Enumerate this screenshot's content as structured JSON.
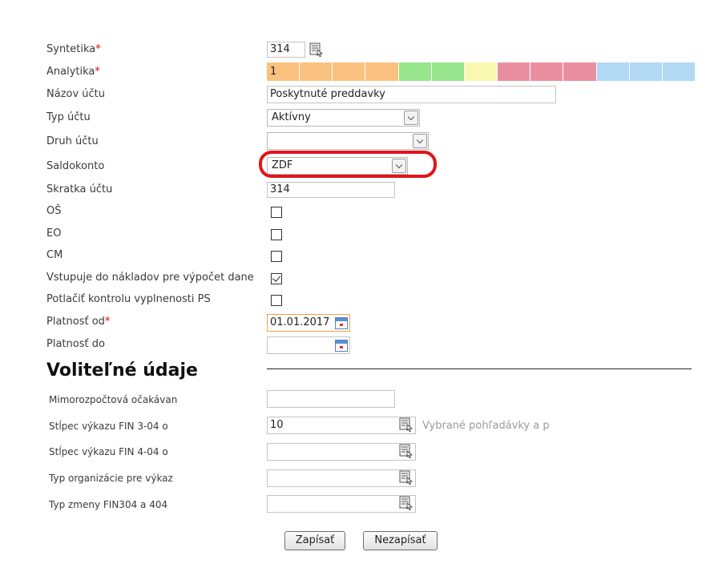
{
  "fields": {
    "syntetika": {
      "label": "Syntetika",
      "required": "*",
      "value": "314"
    },
    "analytika": {
      "label": "Analytika",
      "required": "*",
      "value": "1",
      "segment_colors": [
        "#fbc17e",
        "#fbc17e",
        "#fbc17e",
        "#fbc17e",
        "#97e68c",
        "#97e68c",
        "#faf7b0",
        "#ea8fa2",
        "#ea8fa2",
        "#ea8fa2",
        "#b1d8f5",
        "#b1d8f5",
        "#b1d8f5"
      ]
    },
    "nazov_uctu": {
      "label": "Názov účtu",
      "value": "Poskytnuté preddavky"
    },
    "typ_uctu": {
      "label": "Typ účtu",
      "value": "Aktívny"
    },
    "druh_uctu": {
      "label": "Druh účtu",
      "value": ""
    },
    "saldokonto": {
      "label": "Saldokonto",
      "value": "ZDF"
    },
    "skratka_uctu": {
      "label": "Skratka účtu",
      "value": "314"
    },
    "os": {
      "label": "OŠ",
      "checked": false
    },
    "eo": {
      "label": "EO",
      "checked": false
    },
    "cm": {
      "label": "CM",
      "checked": false
    },
    "vstupuje": {
      "label": "Vstupuje do nákladov pre výpočet dane",
      "checked": true
    },
    "potlacit": {
      "label": "Potlačiť kontrolu vyplnenosti PS",
      "checked": false
    },
    "platnost_od": {
      "label": "Platnosť od",
      "required": "*",
      "value": "01.01.2017"
    },
    "platnost_do": {
      "label": "Platnosť do",
      "value": ""
    }
  },
  "optional": {
    "title": "Voliteľné údaje",
    "mimorozpoctova": {
      "label": "Mimorozpočtová očakávané",
      "value": ""
    },
    "fin304": {
      "label": "Stĺpec výkazu FIN 3-04 o",
      "value": "10",
      "hint": "Vybrané pohľadávky a pô"
    },
    "fin404": {
      "label": "Stĺpec výkazu FIN 4-04 o",
      "value": ""
    },
    "typ_org": {
      "label": "Typ organizácie pre výkaz",
      "value": ""
    },
    "typ_zmeny": {
      "label": "Typ zmeny FIN304 a 404",
      "value": ""
    }
  },
  "buttons": {
    "save": "Zapísať",
    "cancel": "Nezapísať"
  },
  "colors": {
    "highlight_ring": "#e0151b",
    "required": "#e00000"
  }
}
